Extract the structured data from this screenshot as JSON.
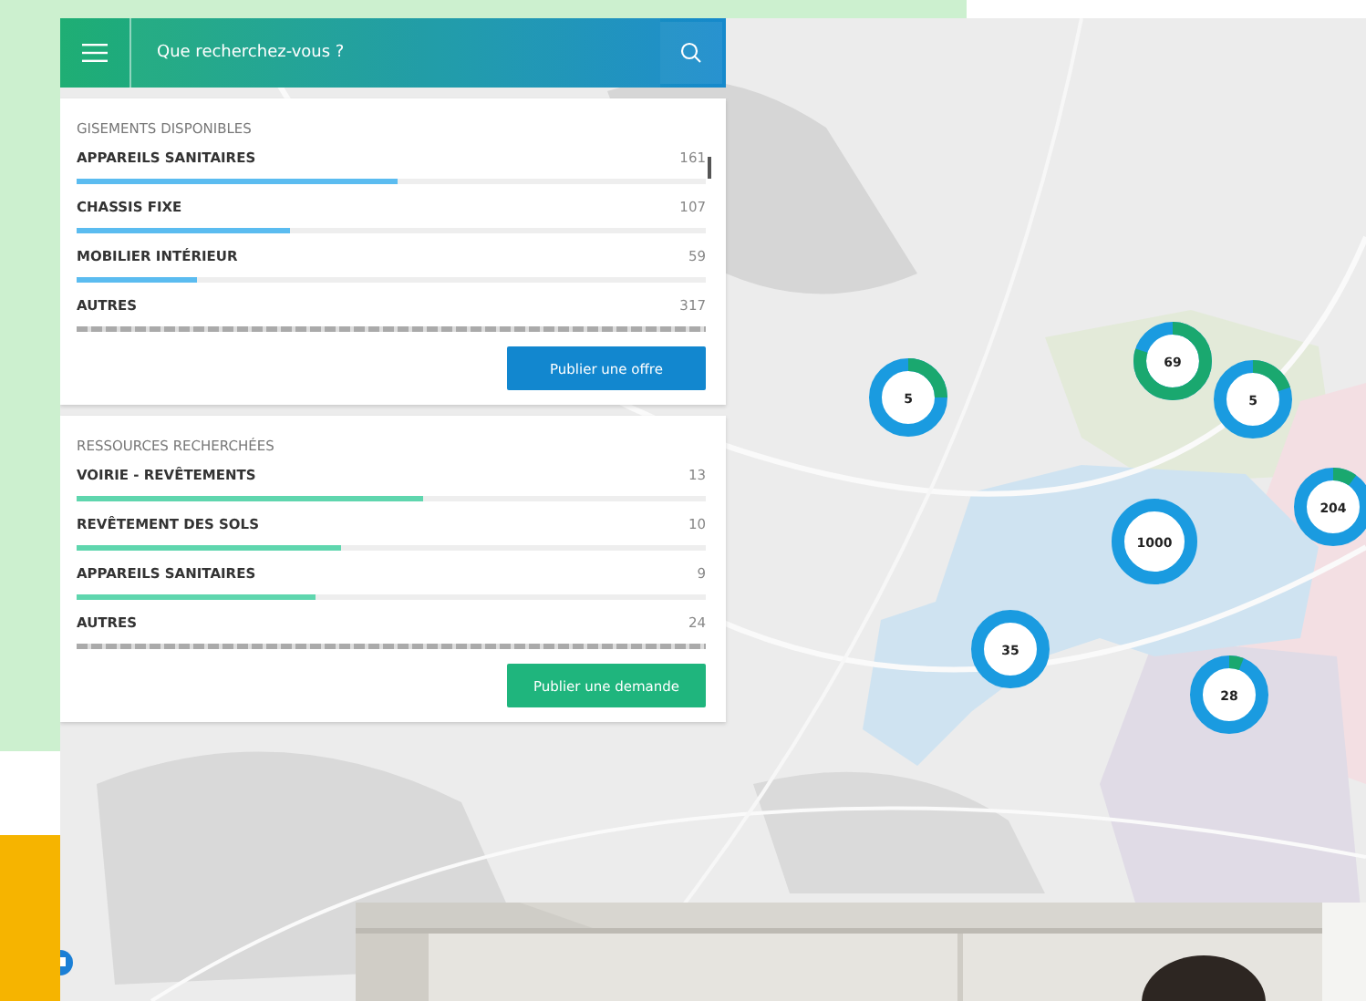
{
  "search": {
    "placeholder": "Que recherchez-vous ?"
  },
  "sections": [
    {
      "title": "GISEMENTS DISPONIBLES",
      "kind": "offer",
      "scrollbar": true,
      "rows": [
        {
          "label": "APPAREILS SANITAIRES",
          "count": "161",
          "kind": "bar",
          "level": 0.51
        },
        {
          "label": "CHASSIS FIXE",
          "count": "107",
          "kind": "bar",
          "level": 0.34
        },
        {
          "label": "MOBILIER INTÉRIEUR",
          "count": "59",
          "kind": "bar",
          "level": 0.19
        },
        {
          "label": "AUTRES",
          "count": "317",
          "kind": "striped"
        }
      ],
      "button": "Publier une offre"
    },
    {
      "title": "RESSOURCES RECHERCHÉES",
      "kind": "request",
      "scrollbar": false,
      "rows": [
        {
          "label": "VOIRIE - REVÊTEMENTS",
          "count": "13",
          "kind": "bar",
          "level": 0.55
        },
        {
          "label": "REVÊTEMENT DES SOLS",
          "count": "10",
          "kind": "bar",
          "level": 0.42
        },
        {
          "label": "APPAREILS SANITAIRES",
          "count": "9",
          "kind": "bar",
          "level": 0.38
        },
        {
          "label": "AUTRES",
          "count": "24",
          "kind": "striped"
        }
      ],
      "button": "Publier une demande"
    }
  ],
  "clusters": [
    {
      "count": "5",
      "level": 0.25
    },
    {
      "count": "69",
      "level": 0.8
    },
    {
      "count": "5",
      "level": 0.2
    },
    {
      "count": "204",
      "level": 0.1
    },
    {
      "count": "1000",
      "level": 0
    },
    {
      "count": "35",
      "level": 0
    },
    {
      "count": "28",
      "level": 0.06
    }
  ]
}
